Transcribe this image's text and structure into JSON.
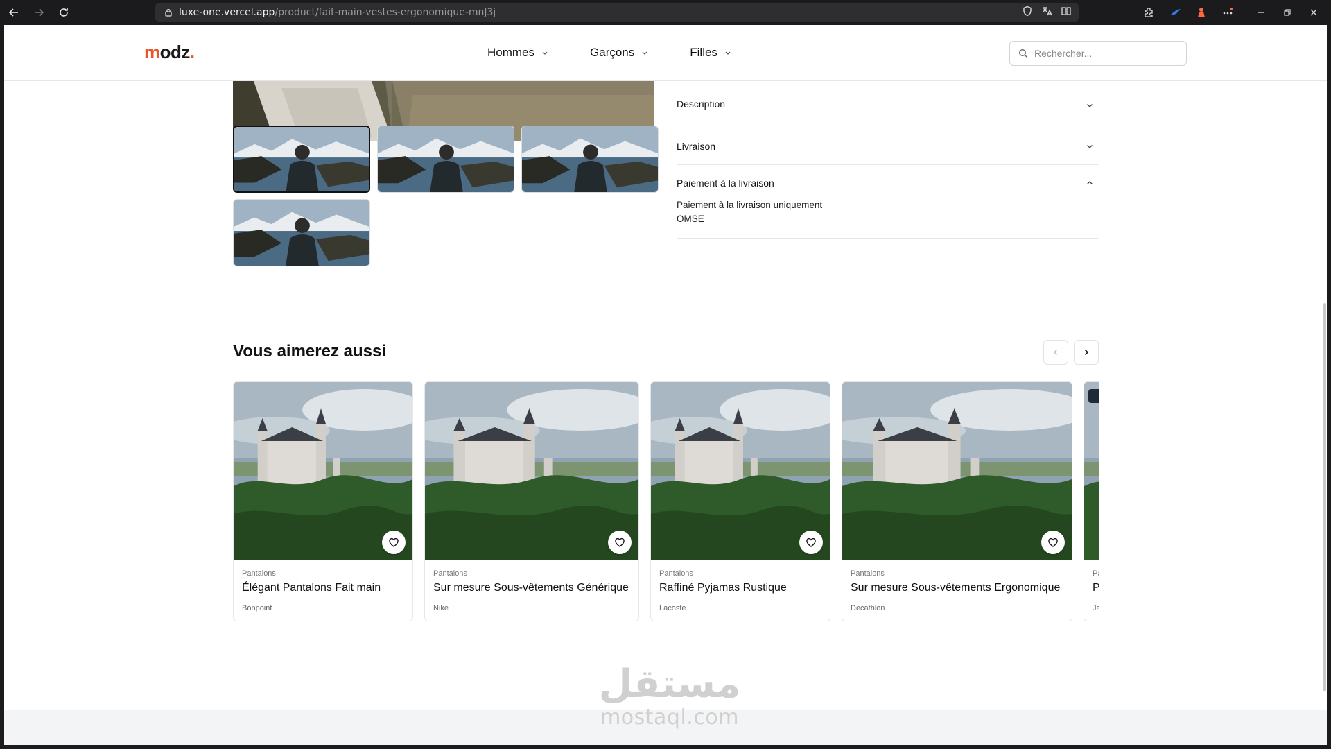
{
  "browser": {
    "url_host": "luxe-one.vercel.app",
    "url_path": "/product/fait-main-vestes-ergonomique-mnJ3j"
  },
  "header": {
    "logo": {
      "m": "m",
      "rest": "odz",
      "dot": "."
    },
    "nav": [
      {
        "label": "Hommes"
      },
      {
        "label": "Garçons"
      },
      {
        "label": "Filles"
      }
    ],
    "search_placeholder": "Rechercher..."
  },
  "accordion": [
    {
      "label": "Description",
      "expanded": false
    },
    {
      "label": "Livraison",
      "expanded": false
    },
    {
      "label": "Paiement à la livraison",
      "expanded": true,
      "body_line1": "Paiement à la livraison uniquement",
      "body_line2": "OMSE"
    }
  ],
  "related": {
    "title": "Vous aimerez aussi",
    "products": [
      {
        "category": "Pantalons",
        "name": "Élégant Pantalons Fait main",
        "brand": "Bonpoint"
      },
      {
        "category": "Pantalons",
        "name": "Sur mesure Sous-vêtements Générique",
        "brand": "Nike"
      },
      {
        "category": "Pantalons",
        "name": "Raffiné Pyjamas Rustique",
        "brand": "Lacoste"
      },
      {
        "category": "Pantalons",
        "name": "Sur mesure Sous-vêtements Ergonomique",
        "brand": "Decathlon"
      },
      {
        "category": "Pa",
        "name": "P",
        "brand": "Ja"
      }
    ]
  },
  "watermark": {
    "arabic": "مستقل",
    "latin": "mostaql.com"
  },
  "colors": {
    "brand_accent": "#e8542b",
    "text": "#111111",
    "border": "#e5e7eb"
  }
}
